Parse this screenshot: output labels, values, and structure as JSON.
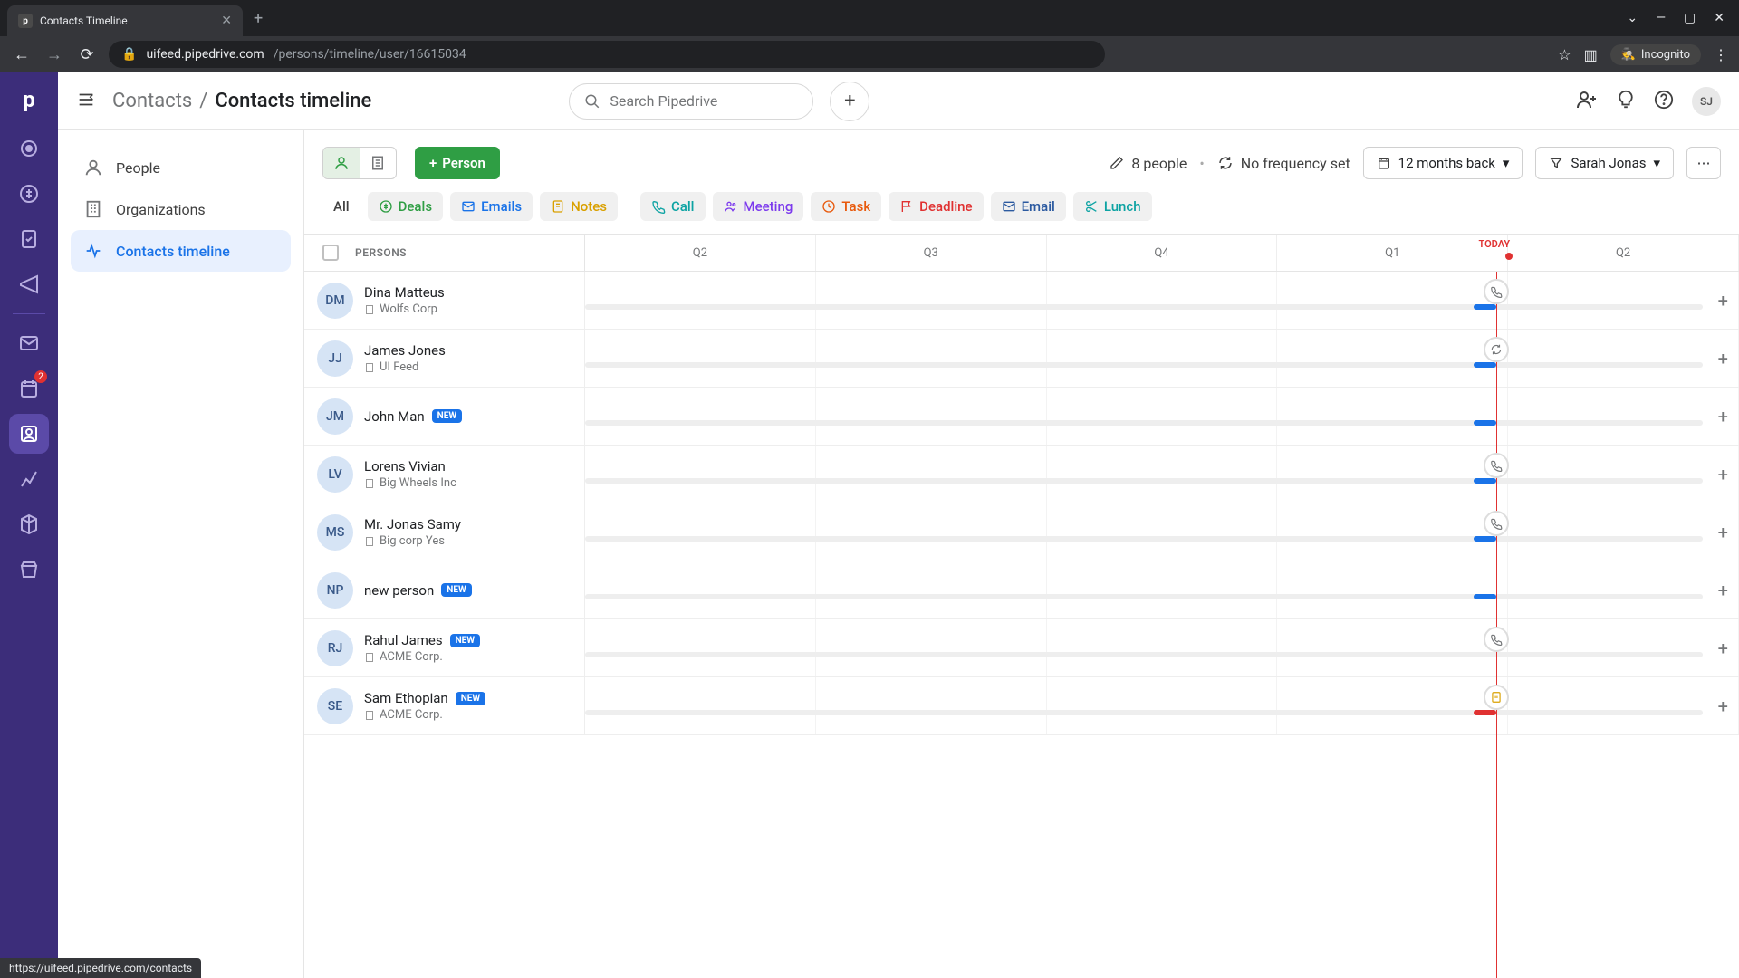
{
  "browser": {
    "tab_title": "Contacts Timeline",
    "favicon_letter": "p",
    "url_host": "uifeed.pipedrive.com",
    "url_path": "/persons/timeline/user/16615034",
    "incognito_label": "Incognito",
    "status_url": "https://uifeed.pipedrive.com/contacts"
  },
  "topbar": {
    "breadcrumb_root": "Contacts",
    "breadcrumb_current": "Contacts timeline",
    "search_placeholder": "Search Pipedrive",
    "user_initials": "SJ"
  },
  "sidebar": {
    "items": [
      {
        "label": "People"
      },
      {
        "label": "Organizations"
      },
      {
        "label": "Contacts timeline"
      }
    ]
  },
  "toolbar": {
    "person_btn": "Person",
    "people_count": "8 people",
    "frequency": "No frequency set",
    "range": "12 months back",
    "owner": "Sarah Jonas"
  },
  "filters": {
    "all": "All",
    "deals": "Deals",
    "emails": "Emails",
    "notes": "Notes",
    "call": "Call",
    "meeting": "Meeting",
    "task": "Task",
    "deadline": "Deadline",
    "email": "Email",
    "lunch": "Lunch"
  },
  "timeline_header": {
    "persons": "PERSONS",
    "quarters": [
      "Q2",
      "Q3",
      "Q4",
      "Q1",
      "Q2"
    ],
    "today": "TODAY"
  },
  "rail_badge": "2",
  "persons": [
    {
      "initials": "DM",
      "name": "Dina Matteus",
      "org": "Wolfs Corp",
      "new": false,
      "icon": "call",
      "fill_color": "blue"
    },
    {
      "initials": "JJ",
      "name": "James Jones",
      "org": "UI Feed",
      "new": false,
      "icon": "sync",
      "fill_color": "blue"
    },
    {
      "initials": "JM",
      "name": "John Man",
      "org": "",
      "new": true,
      "icon": "",
      "fill_color": "blue"
    },
    {
      "initials": "LV",
      "name": "Lorens Vivian",
      "org": "Big Wheels Inc",
      "new": false,
      "icon": "call",
      "fill_color": "blue"
    },
    {
      "initials": "MS",
      "name": "Mr. Jonas Samy",
      "org": "Big corp Yes",
      "new": false,
      "icon": "call",
      "fill_color": "blue"
    },
    {
      "initials": "NP",
      "name": "new person",
      "org": "",
      "new": true,
      "icon": "",
      "fill_color": "blue"
    },
    {
      "initials": "RJ",
      "name": "Rahul James",
      "org": "ACME Corp.",
      "new": true,
      "icon": "call",
      "fill_color": ""
    },
    {
      "initials": "SE",
      "name": "Sam Ethopian",
      "org": "ACME Corp.",
      "new": true,
      "icon": "note",
      "fill_color": "red"
    }
  ]
}
